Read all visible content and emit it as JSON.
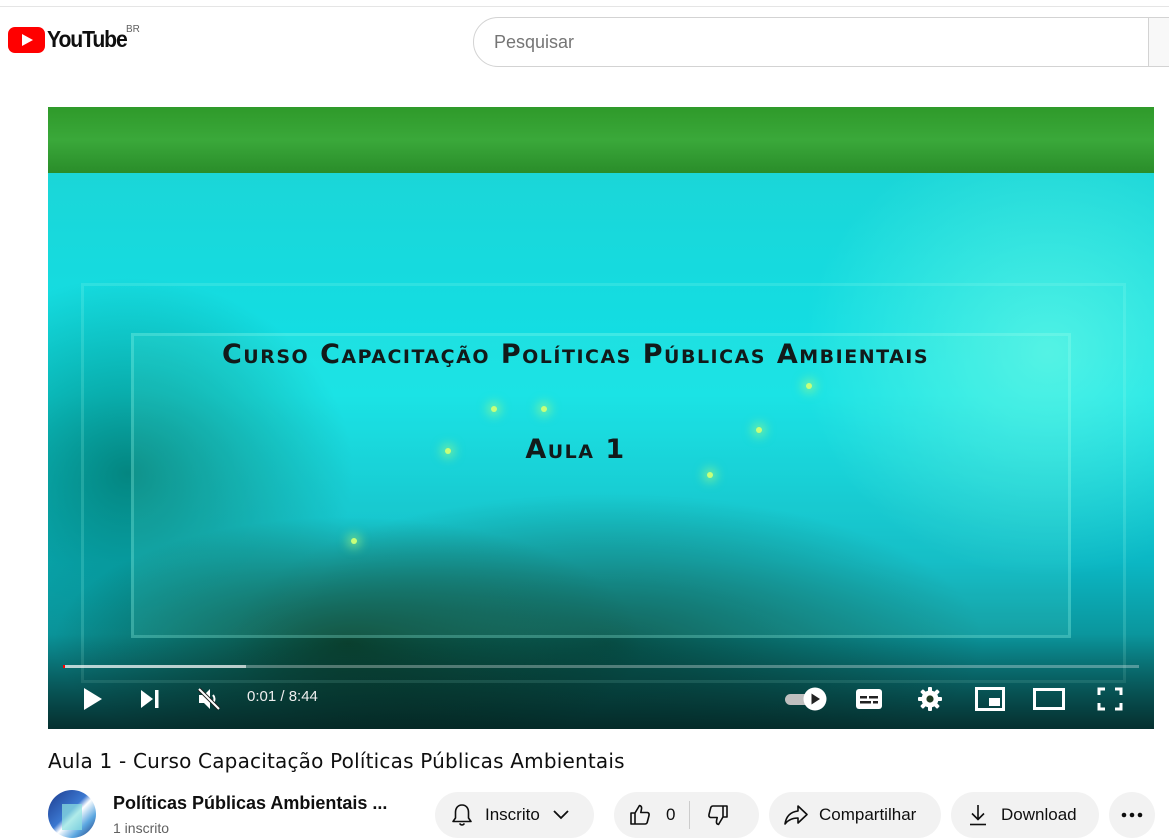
{
  "header": {
    "logo_text": "YouTube",
    "region": "BR",
    "search_placeholder": "Pesquisar"
  },
  "player": {
    "overlay_title": "Curso Capacitação Políticas Públicas Ambientais",
    "overlay_subtitle": "Aula 1",
    "current_time": "0:01",
    "duration": "8:44",
    "time_display": "0:01 / 8:44",
    "progress_fraction": 0.002,
    "buffer_fraction": 0.17,
    "muted": true,
    "autoplay_on": true
  },
  "video": {
    "title": "Aula 1 - Curso Capacitação Políticas Públicas Ambientais"
  },
  "channel": {
    "name": "Políticas Públicas Ambientais ...",
    "subscribers": "1 inscrito"
  },
  "actions": {
    "subscribe_label": "Inscrito",
    "like_count": "0",
    "share_label": "Compartilhar",
    "download_label": "Download"
  },
  "colors": {
    "brand_red": "#ff0000",
    "pill_bg": "#f2f2f2"
  },
  "icons": [
    "youtube-logo-icon",
    "play-icon",
    "next-icon",
    "muted-volume-icon",
    "autoplay-toggle-icon",
    "subtitles-icon",
    "settings-gear-icon",
    "miniplayer-icon",
    "theater-mode-icon",
    "fullscreen-icon",
    "bell-icon",
    "chevron-down-icon",
    "thumbs-up-icon",
    "thumbs-down-icon",
    "share-arrow-icon",
    "download-icon",
    "more-dots-icon"
  ]
}
